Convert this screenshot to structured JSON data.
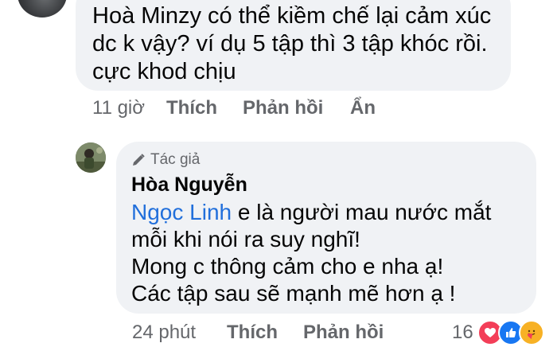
{
  "comment1": {
    "text_lines": [
      "Hoà Minzy có thể kiềm chế lại cảm xúc",
      "dc k vậy? ví dụ 5 tập thì 3 tập khóc rồi.",
      "cực khod chịu"
    ],
    "time": "11 giờ",
    "like_label": "Thích",
    "reply_label": "Phản hồi",
    "hide_label": "Ẩn"
  },
  "reply": {
    "author_badge": "Tác giả",
    "author_name": "Hòa Nguyễn",
    "mention": "Ngọc Linh",
    "text_line1_rest": " e là người mau nước mắt",
    "text_lines": [
      "mỗi khi nói ra suy nghĩ!",
      "Mong c thông cảm cho e nha ạ!",
      "Các tập sau sẽ mạnh mẽ hơn ạ !"
    ],
    "time": "24 phút",
    "like_label": "Thích",
    "reply_label": "Phản hồi",
    "reaction_count": "16",
    "reactions": [
      "love-reaction-icon",
      "like-reaction-icon",
      "care-reaction-icon"
    ]
  },
  "colors": {
    "bubble": "#f0f2f5",
    "meta_text": "#65676b",
    "mention": "#216fdb",
    "love": "#f33e58",
    "like": "#1877f2",
    "care": "#f7b125"
  }
}
